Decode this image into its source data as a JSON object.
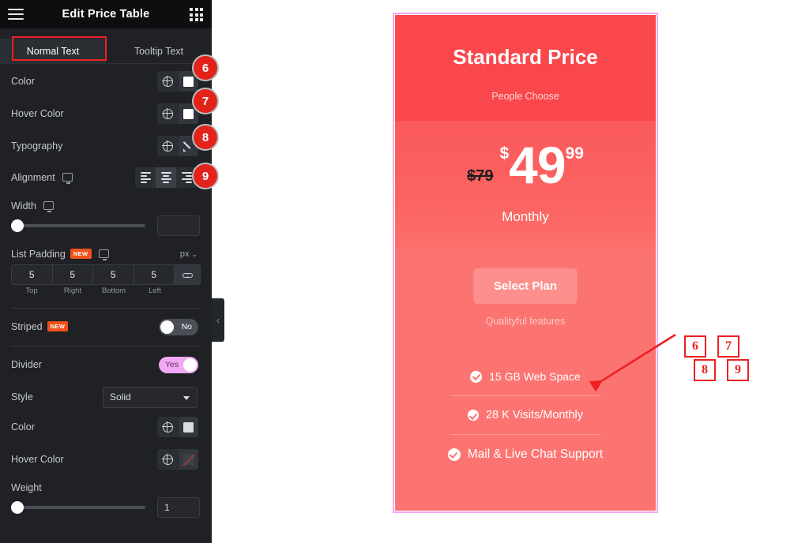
{
  "panel": {
    "title": "Edit Price Table",
    "menu_icon": "hamburger-icon",
    "apps_icon": "grid-icon",
    "tabs": [
      {
        "label": "Normal Text",
        "active": true
      },
      {
        "label": "Tooltip Text",
        "active": false
      }
    ],
    "controls": {
      "color": {
        "label": "Color",
        "globe": "globe-icon",
        "swatch": "#ffffff"
      },
      "hover_color": {
        "label": "Hover Color",
        "globe": "globe-icon",
        "swatch": "#ffffff"
      },
      "typography": {
        "label": "Typography",
        "globe": "globe-icon",
        "edit": "pencil-icon"
      },
      "alignment": {
        "label": "Alignment",
        "device": "monitor-icon",
        "options": [
          "left",
          "center",
          "right"
        ],
        "selected": "center"
      },
      "width": {
        "label": "Width",
        "device": "monitor-icon",
        "value": "",
        "slider_percent": 0
      },
      "list_padding": {
        "label": "List Padding",
        "badge": "NEW",
        "device": "monitor-icon",
        "unit": "px",
        "fields": [
          {
            "value": "5",
            "label": "Top"
          },
          {
            "value": "5",
            "label": "Right"
          },
          {
            "value": "5",
            "label": "Bottom"
          },
          {
            "value": "5",
            "label": "Left"
          }
        ],
        "link_icon": "link-icon"
      },
      "striped": {
        "label": "Striped",
        "badge": "NEW",
        "state": "No",
        "on": false
      },
      "divider": {
        "label": "Divider",
        "state": "Yes",
        "on": true
      },
      "style": {
        "label": "Style",
        "value": "Solid"
      },
      "divider_color": {
        "label": "Color",
        "globe": "globe-icon",
        "swatch": "#d9dbde"
      },
      "divider_hover_color": {
        "label": "Hover Color",
        "globe": "globe-icon",
        "swatch": "none"
      },
      "weight": {
        "label": "Weight",
        "value": "1",
        "slider_percent": 0
      }
    },
    "collapse_icon": "chevron-left-icon",
    "callouts": [
      "6",
      "7",
      "8",
      "9"
    ]
  },
  "card": {
    "header": {
      "title": "Standard Price",
      "subtitle": "People Choose"
    },
    "price": {
      "original": "$79",
      "currency": "$",
      "integer": "49",
      "fraction": "99",
      "period": "Monthly"
    },
    "cta": {
      "label": "Select Plan",
      "caption": "Qualityful features"
    },
    "features": [
      {
        "text": "15 GB Web Space",
        "check": "check-circle-icon"
      },
      {
        "text": "28 K Visits/Monthly",
        "check": "check-circle-icon"
      },
      {
        "text": "Mail & Live Chat Support",
        "check": "check-circle-icon"
      }
    ],
    "colors": {
      "header_bg": "#f9474c",
      "price_bg": "#fb5f5f",
      "body_bg": "#fc7471",
      "button_bg": "#fd908c",
      "selection_border": "#f0a9f5"
    }
  },
  "annotation": {
    "arrow": "red-arrow",
    "numbers": [
      "6",
      "7",
      "8",
      "9"
    ],
    "color": "#ed2024"
  }
}
